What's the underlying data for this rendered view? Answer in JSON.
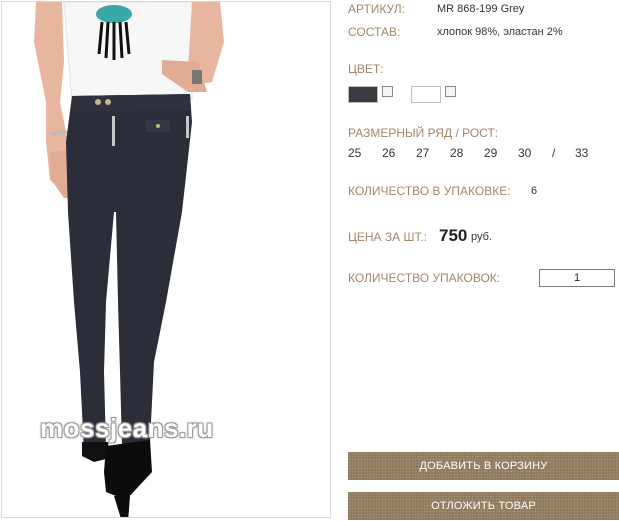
{
  "product": {
    "article_label": "АРТИКУЛ:",
    "article_value": "MR 868-199 Grey",
    "composition_label": "СОСТАВ:",
    "composition_value": "хлопок 98%, эластан 2%",
    "color_label": "ЦВЕТ:",
    "colors": [
      {
        "name": "dark-grey",
        "hex": "#3a3b40"
      },
      {
        "name": "white",
        "hex": "#ffffff"
      }
    ],
    "sizes_label": "РАЗМЕРНЫЙ РЯД / РОСТ:",
    "sizes": [
      "25",
      "26",
      "27",
      "28",
      "29",
      "30",
      "/",
      "33"
    ],
    "pack_qty_label": "КОЛИЧЕСТВО В УПАКОВКЕ:",
    "pack_qty_value": "6",
    "price_label": "ЦЕНА ЗА ШТ.:",
    "price_value": "750",
    "price_currency": "руб.",
    "packs_label": "КОЛИЧЕСТВО УПАКОВОК:",
    "packs_value": "1"
  },
  "image": {
    "watermark": "mossjeans.ru"
  },
  "actions": {
    "add_to_cart": "ДОБАВИТЬ В КОРЗИНУ",
    "postpone": "ОТЛОЖИТЬ ТОВАР"
  },
  "colors": {
    "label": "#a0876a",
    "button": "#8d7659"
  }
}
